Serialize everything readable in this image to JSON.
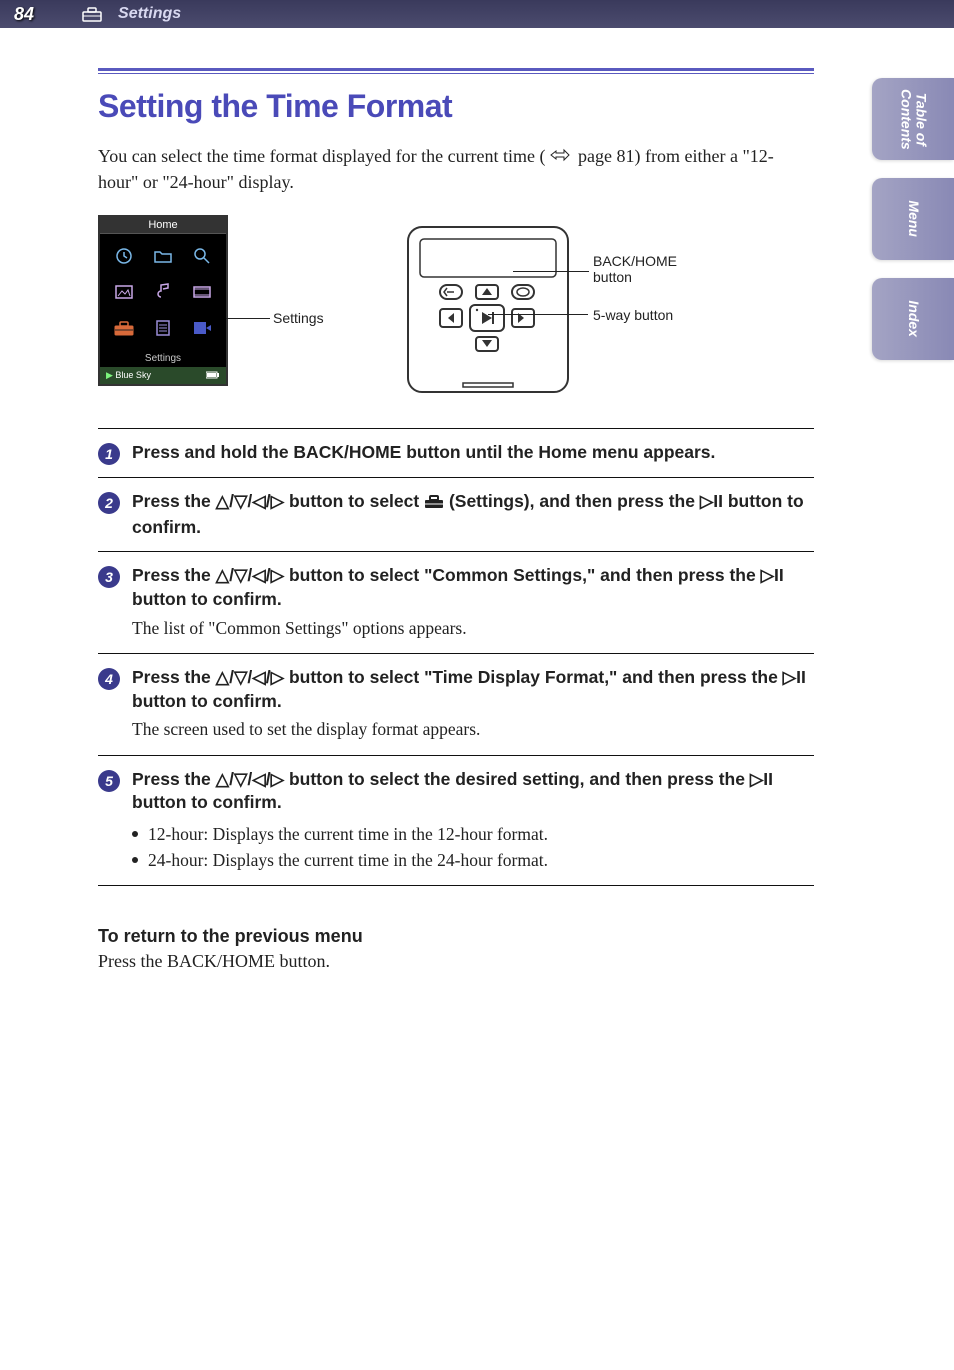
{
  "header": {
    "page_number": "84",
    "section": "Settings"
  },
  "side_tabs": [
    "Table of\nContents",
    "Menu",
    "Index"
  ],
  "title": "Setting the Time Format",
  "intro_part1": "You can select the time format displayed for the current time (",
  "page_ref": "page 81",
  "intro_part2": ") from either a \"12-hour\" or \"24-hour\" display.",
  "diagram": {
    "screen_title": "Home",
    "screen_caption": "Settings",
    "screen_caption2": "Settings",
    "now_playing": "Blue Sky",
    "device_label1": "BACK/HOME button",
    "device_label2": "5-way button"
  },
  "steps": [
    {
      "num": "1",
      "title": "Press and hold the BACK/HOME button until the Home menu appears."
    },
    {
      "num": "2",
      "title_pre": "Press the ",
      "title_mid": " button to select ",
      "title_settings": " (Settings), and then press the ",
      "title_post": " button to confirm."
    },
    {
      "num": "3",
      "title_pre": "Press the ",
      "title_mid": " button to select \"Common Settings,\" and then press the ",
      "title_post": " button to confirm.",
      "sub": "The list of \"Common Settings\" options appears."
    },
    {
      "num": "4",
      "title_pre": "Press the ",
      "title_mid": " button to select \"Time Display Format,\" and then press the ",
      "title_post": " button to confirm.",
      "sub": "The screen used to set the display format appears."
    },
    {
      "num": "5",
      "title_pre": "Press the ",
      "title_mid": " button to select the desired setting, and then press the ",
      "title_post": " button to confirm.",
      "bullets": [
        "12-hour: Displays the current time in the 12-hour format.",
        "24-hour: Displays the current time in the 24-hour format."
      ]
    }
  ],
  "return": {
    "title": "To return to the previous menu",
    "body": "Press the BACK/HOME button."
  }
}
